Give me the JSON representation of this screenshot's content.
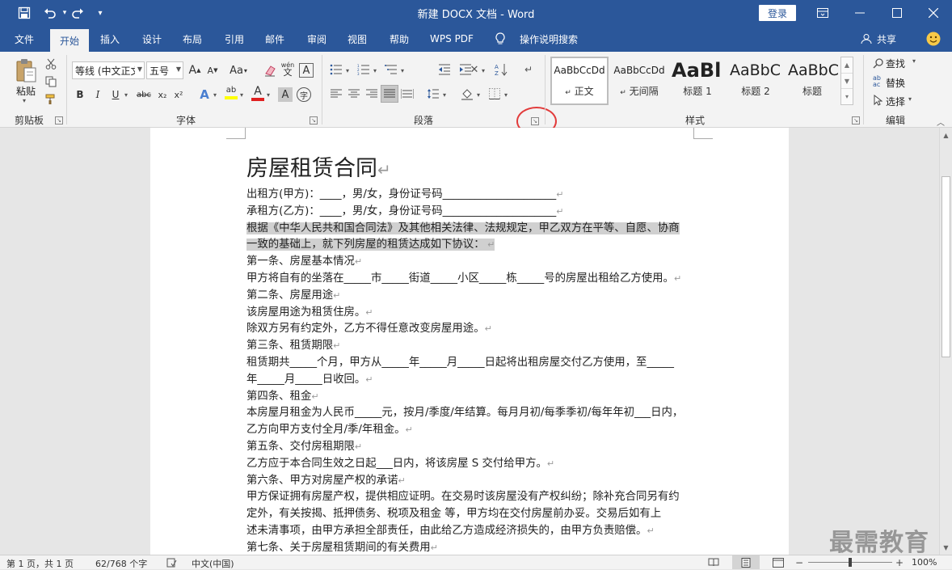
{
  "titlebar": {
    "title": "新建 DOCX 文档  -  Word",
    "login": "登录"
  },
  "tabs": [
    "文件",
    "开始",
    "插入",
    "设计",
    "布局",
    "引用",
    "邮件",
    "审阅",
    "视图",
    "帮助",
    "WPS PDF",
    "操作说明搜索"
  ],
  "share": "共享",
  "ribbon": {
    "clipboard": {
      "paste": "粘贴",
      "label": "剪贴板"
    },
    "font": {
      "font_name": "等线 (中文正文)",
      "font_size": "五号",
      "label": "字体",
      "grow": "A",
      "shrink": "A",
      "case": "Aa",
      "pinyin": "wén",
      "border_char": "A",
      "bold": "B",
      "italic": "I",
      "underline": "U",
      "strike": "abc",
      "sub": "x₂",
      "sup": "x²",
      "effects": "A",
      "highlight": "ab",
      "color": "A",
      "shade": "A",
      "enclose": "字"
    },
    "paragraph": {
      "label": "段落"
    },
    "styles": {
      "label": "样式",
      "items": [
        {
          "preview": "AaBbCcDd",
          "name": "正文"
        },
        {
          "preview": "AaBbCcDd",
          "name": "无间隔"
        },
        {
          "preview": "AaBl",
          "name": "标题 1"
        },
        {
          "preview": "AaBbC",
          "name": "标题 2"
        },
        {
          "preview": "AaBbC",
          "name": "标题"
        }
      ]
    },
    "editing": {
      "find": "查找",
      "replace": "替换",
      "select": "选择",
      "label": "编辑"
    }
  },
  "document": {
    "title": "房屋租赁合同",
    "lines": [
      "出租方(甲方)：____，男/女，身份证号码_____________________",
      "承租方(乙方)：____，男/女，身份证号码_____________________",
      "根据《中华人民共和国合同法》及其他相关法律、法规规定，甲乙双方在平等、自愿、协商",
      "一致的基础上，就下列房屋的租赁达成如下协议：",
      "第一条、房屋基本情况",
      "甲方将自有的坐落在_____市_____街道_____小区_____栋_____号的房屋出租给乙方使用。",
      "第二条、房屋用途",
      "该房屋用途为租赁住房。",
      "除双方另有约定外，乙方不得任意改变房屋用途。",
      "第三条、租赁期限",
      "租赁期共_____个月，甲方从_____年_____月_____日起将出租房屋交付乙方使用，至_____",
      "年_____月_____日收回。",
      "第四条、租金",
      "本房屋月租金为人民币_____元，按月/季度/年结算。每月月初/每季季初/每年年初___日内，",
      "乙方向甲方支付全月/季/年租金。",
      "第五条、交付房租期限",
      "乙方应于本合同生效之日起___日内，将该房屋 S 交付给甲方。",
      "第六条、甲方对房屋产权的承诺",
      "甲方保证拥有房屋产权，提供相应证明。在交易时该房屋没有产权纠纷；除补充合同另有约",
      "定外，有关按揭、抵押债务、税项及租金        等，甲方均在交付房屋前办妥。交易后如有上",
      "述未清事项，由甲方承担全部责任，由此给乙方造成经济损失的，由甲方负责赔偿。",
      "第七条、关于房屋租赁期间的有关费用"
    ]
  },
  "watermark": "最需教育",
  "statusbar": {
    "page": "第 1 页，共 1 页",
    "words": "62/768 个字",
    "lang": "中文(中国)",
    "zoom": "100%"
  },
  "colors": {
    "accent": "#2b579a",
    "highlight_circle": "#e23b3b"
  }
}
